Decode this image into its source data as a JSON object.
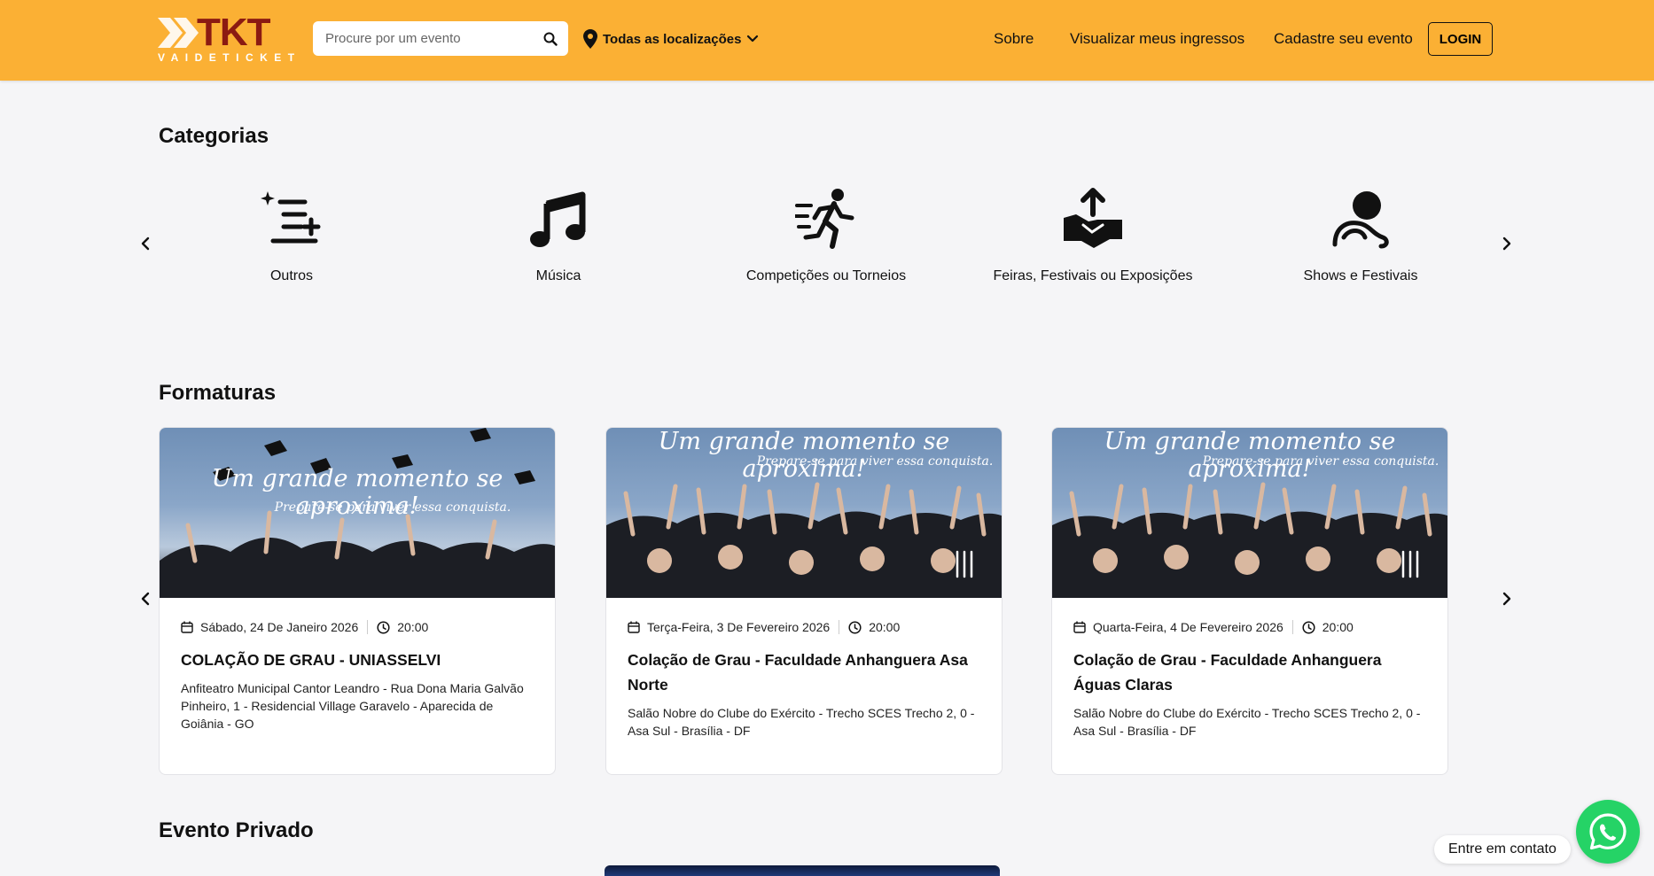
{
  "header": {
    "logo_text": "TKT",
    "logo_subtext": "VAIDETICKET",
    "search_placeholder": "Procure por um evento",
    "location_label": "Todas as localizações",
    "nav": [
      "Sobre",
      "Visualizar meus ingressos",
      "Cadastre seu evento"
    ],
    "login_label": "LOGIN"
  },
  "colors": {
    "header_bg": "#fbb034",
    "whatsapp": "#25d366"
  },
  "categories": {
    "title": "Categorias",
    "items": [
      {
        "label": "Outros",
        "icon": "list-plus-icon"
      },
      {
        "label": "Música",
        "icon": "music-note-icon"
      },
      {
        "label": "Competições ou Torneios",
        "icon": "running-person-icon"
      },
      {
        "label": "Feiras, Festivais ou Exposições",
        "icon": "handshake-icon"
      },
      {
        "label": "Shows e Festivais",
        "icon": "person-icon"
      }
    ]
  },
  "formaturas": {
    "title": "Formaturas",
    "banner_headline": "Um grande momento se aproxima!",
    "banner_sub": "Prepare-se para viver essa conquista.",
    "cards": [
      {
        "date": "Sábado, 24 De Janeiro 2026",
        "time": "20:00",
        "title": "COLAÇÃO DE GRAU - UNIASSELVI",
        "address": "Anfiteatro Municipal Cantor Leandro - Rua Dona Maria Galvão Pinheiro, 1 - Residencial Village Garavelo - Aparecida de Goiânia - GO"
      },
      {
        "date": "Terça-Feira, 3 De Fevereiro 2026",
        "time": "20:00",
        "title": "Colação de Grau - Faculdade Anhanguera Asa Norte",
        "address": "Salão Nobre do Clube do Exército - Trecho SCES Trecho 2, 0 - Asa Sul - Brasília - DF"
      },
      {
        "date": "Quarta-Feira, 4 De Fevereiro 2026",
        "time": "20:00",
        "title": "Colação de Grau - Faculdade Anhanguera Águas Claras",
        "address": "Salão Nobre do Clube do Exército - Trecho SCES Trecho 2, 0 - Asa Sul - Brasília - DF"
      }
    ]
  },
  "evento_privado": {
    "title": "Evento Privado"
  },
  "contact": {
    "label": "Entre em contato"
  }
}
